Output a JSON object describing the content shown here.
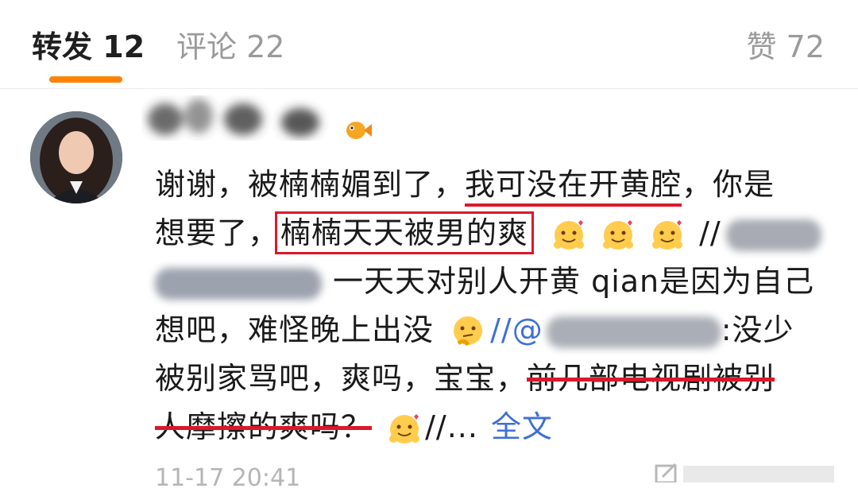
{
  "tabs": {
    "repost": {
      "label": "转发",
      "count": "12"
    },
    "comment": {
      "label": "评论",
      "count": "22"
    },
    "like": {
      "label": "赞",
      "count": "72"
    }
  },
  "post": {
    "line1_a": "谢谢，被楠楠媚到了，",
    "line1_underlined": "我可没在开黄腔",
    "line1_b": "，你是",
    "line2_a": "想要了，",
    "line2_boxed": "楠楠天天被男的爽",
    "line2_c": "//",
    "line3_b": "一天天对别人开黄 qian是因为自己",
    "line4_a": "想吧，难怪晚上出没",
    "line4_b": "//@",
    "line4_c": ":没少",
    "line5_a": "被别家骂吧，爽吗，宝宝，",
    "line5_strike": "前几部电视剧被别",
    "line6_strike": "人摩擦的爽吗？",
    "line6_b": "//...",
    "fulltext": "全文",
    "timestamp": "11-17 20:41"
  },
  "colors": {
    "accent": "#ff8200",
    "annotation": "#d9192a",
    "link": "#3f6fd6"
  },
  "icons": [
    "hug-emoji",
    "thinking-emoji",
    "fish-emoji",
    "share-icon",
    "comment-icon",
    "like-icon"
  ]
}
